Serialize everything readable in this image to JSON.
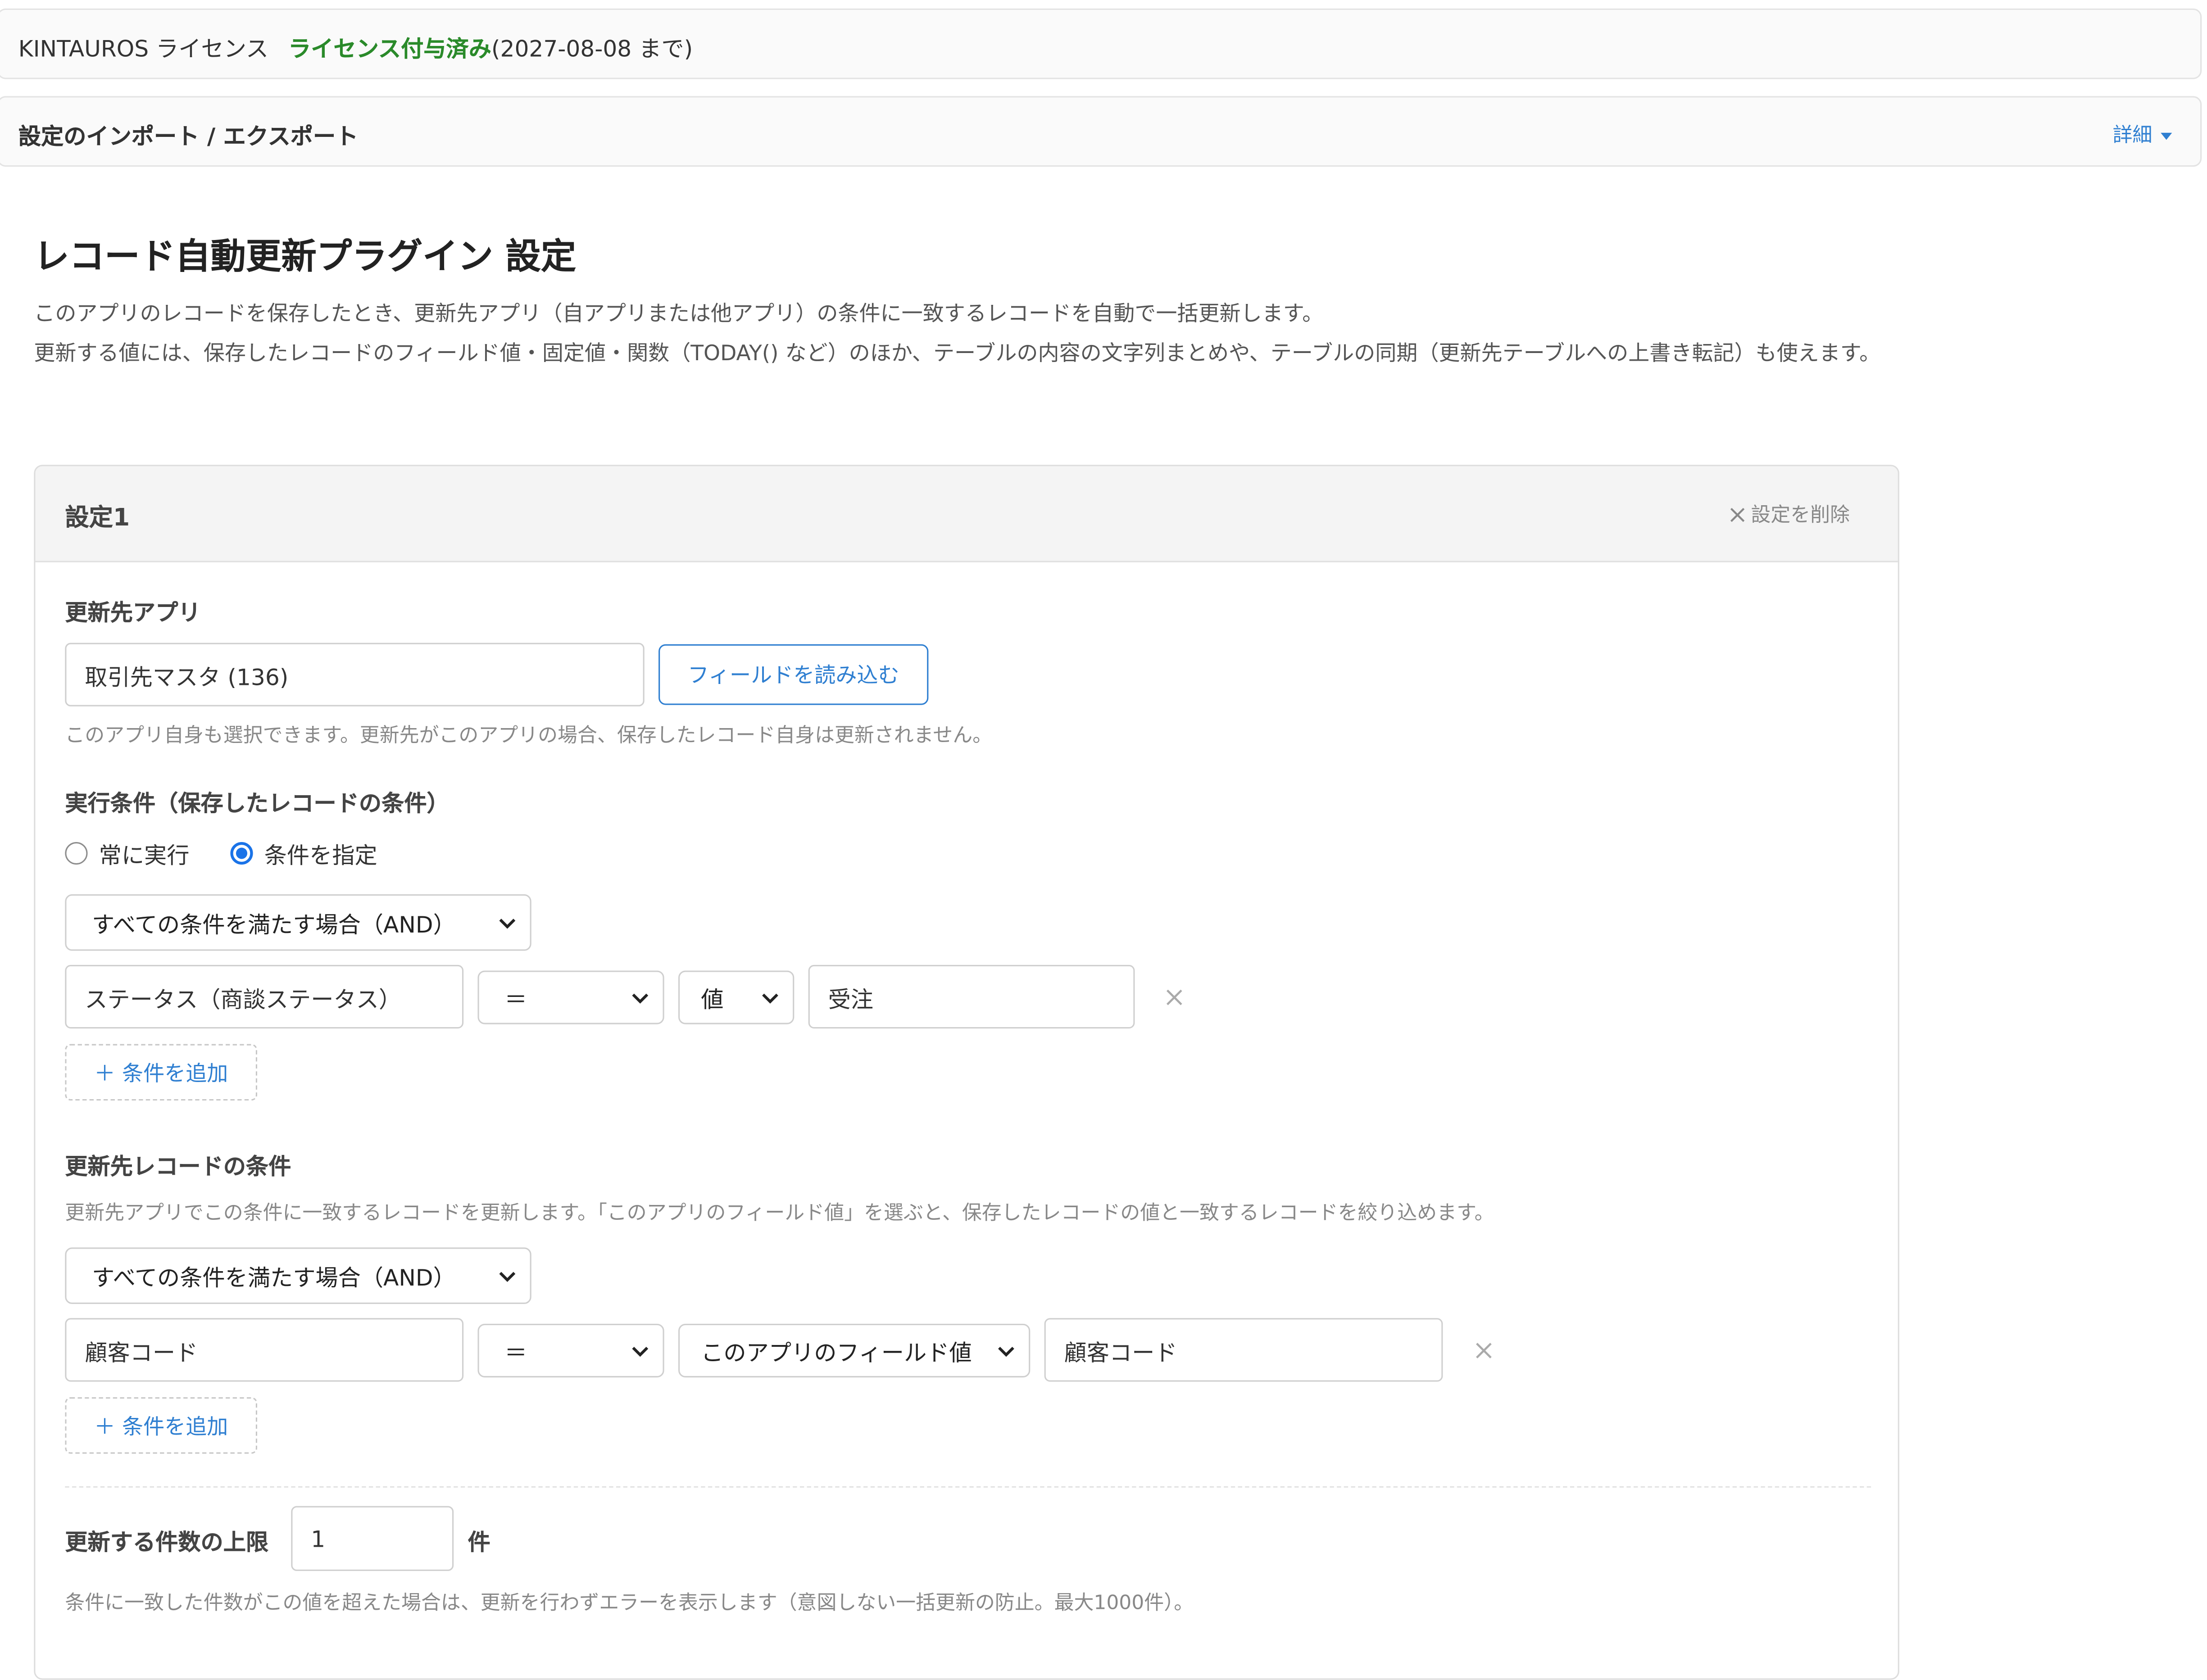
{
  "license": {
    "product": "KINTAUROS ライセンス",
    "status": "ライセンス付与済み",
    "until": "(2027-08-08 まで)"
  },
  "import_export": {
    "title": "設定のインポート / エクスポート",
    "detail_label": "詳細"
  },
  "page": {
    "title": "レコード自動更新プラグイン 設定",
    "desc_line1": "このアプリのレコードを保存したとき、更新先アプリ（自アプリまたは他アプリ）の条件に一致するレコードを自動で一括更新します。",
    "desc_line2": "更新する値には、保存したレコードのフィールド値・固定値・関数（TODAY() など）のほか、テーブルの内容の文字列まとめや、テーブルの同期（更新先テーブルへの上書き転記）も使えます。"
  },
  "setting": {
    "label": "設定1",
    "delete_label": "設定を削除",
    "target_app": {
      "label": "更新先アプリ",
      "value": "取引先マスタ (136)",
      "load_button": "フィールドを読み込む",
      "note": "このアプリ自身も選択できます。更新先がこのアプリの場合、保存したレコード自身は更新されません。"
    },
    "exec_condition": {
      "label": "実行条件（保存したレコードの条件）",
      "radio_always": "常に実行",
      "radio_specify": "条件を指定",
      "selected": "specify",
      "logic": "すべての条件を満たす場合（AND）",
      "row": {
        "field": "ステータス（商談ステータス）",
        "operator": "＝",
        "type": "値",
        "value": "受注"
      },
      "add_label": "＋ 条件を追加"
    },
    "target_condition": {
      "label": "更新先レコードの条件",
      "note": "更新先アプリでこの条件に一致するレコードを更新します。「このアプリのフィールド値」を選ぶと、保存したレコードの値と一致するレコードを絞り込めます。",
      "logic": "すべての条件を満たす場合（AND）",
      "row": {
        "field": "顧客コード",
        "operator": "＝",
        "type": "このアプリのフィールド値",
        "value": "顧客コード"
      },
      "add_label": "＋ 条件を追加"
    },
    "limit": {
      "label": "更新する件数の上限",
      "value": "1",
      "unit": "件",
      "note": "条件に一致した件数がこの値を超えた場合は、更新を行わずエラーを表示します（意図しない一括更新の防止。最大1000件）。"
    }
  },
  "colors": {
    "accent": "#2f7fd1",
    "license_ok": "#2a8a2a",
    "radio_on": "#1a73e8"
  }
}
